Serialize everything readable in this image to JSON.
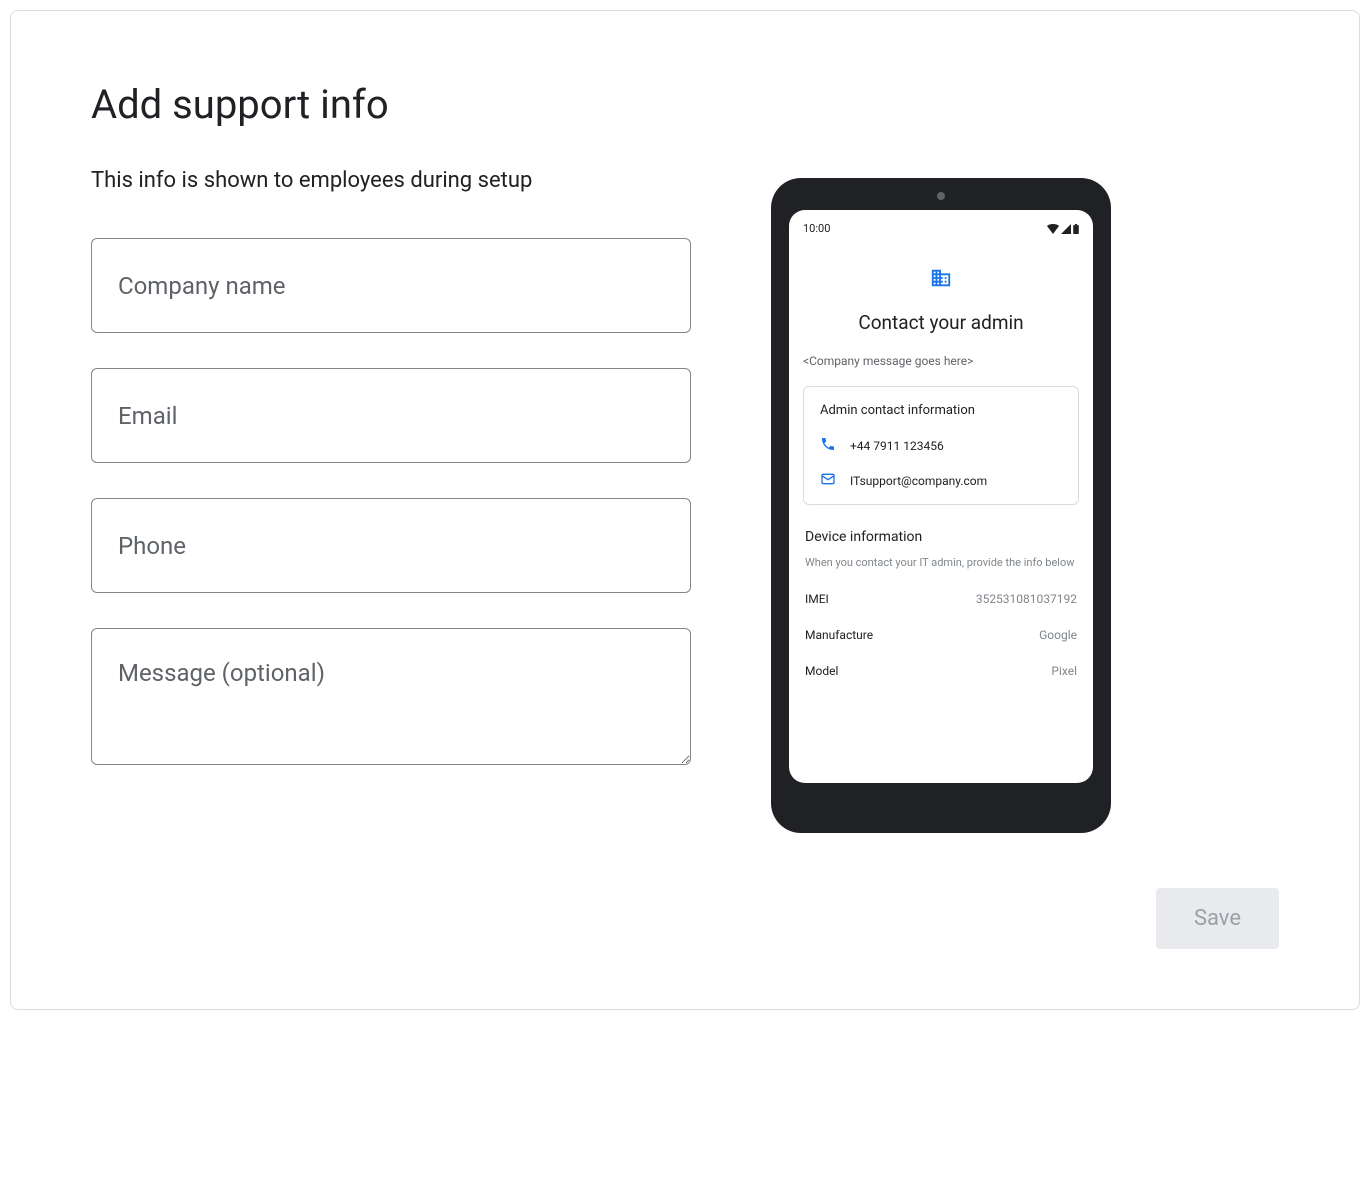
{
  "header": {
    "title": "Add support info",
    "subtitle": "This info is shown to employees during setup"
  },
  "form": {
    "company_placeholder": "Company name",
    "email_placeholder": "Email",
    "phone_placeholder": "Phone",
    "message_placeholder": "Message (optional)"
  },
  "preview": {
    "time": "10:00",
    "title": "Contact your admin",
    "company_message": "<Company message goes here>",
    "admin_card_title": "Admin contact information",
    "phone": "+44 7911 123456",
    "email": "ITsupport@company.com",
    "device_section_title": "Device information",
    "device_section_subtitle": "When you contact your IT admin, provide the info below",
    "rows": [
      {
        "label": "IMEI",
        "value": "352531081037192"
      },
      {
        "label": "Manufacture",
        "value": "Google"
      },
      {
        "label": "Model",
        "value": "Pixel"
      }
    ]
  },
  "actions": {
    "save_label": "Save"
  }
}
